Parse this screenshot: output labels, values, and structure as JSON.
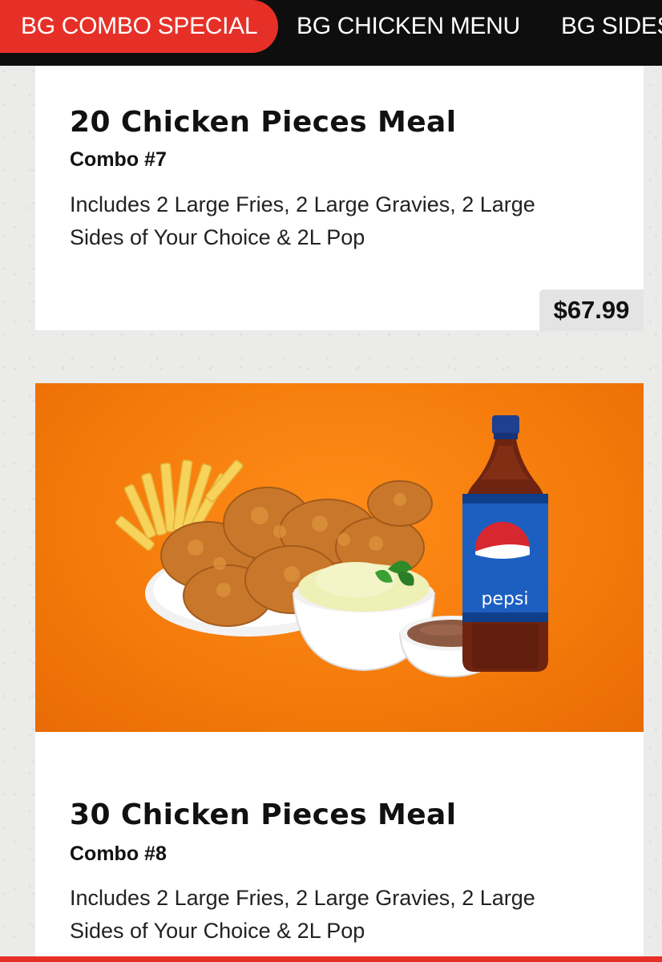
{
  "nav": {
    "tabs": [
      {
        "label": "BG COMBO SPECIAL",
        "active": true
      },
      {
        "label": "BG CHICKEN MENU",
        "active": false
      },
      {
        "label": "BG SIDES",
        "active": false
      }
    ]
  },
  "menu_items": [
    {
      "title": "20 Chicken Pieces Meal",
      "combo": "Combo #7",
      "description": "Includes 2 Large Fries, 2 Large Gravies, 2 Large Sides of Your Choice & 2L Pop",
      "price": "$67.99"
    },
    {
      "title": "30 Chicken Pieces Meal",
      "combo": "Combo #8",
      "description": "Includes 2 Large Fries, 2 Large Gravies, 2 Large Sides of Your Choice & 2L Pop",
      "photo_label": "pepsi"
    }
  ],
  "colors": {
    "accent": "#e63027",
    "nav_background": "#0e0e0e",
    "photo_background": "#f47a0a"
  }
}
